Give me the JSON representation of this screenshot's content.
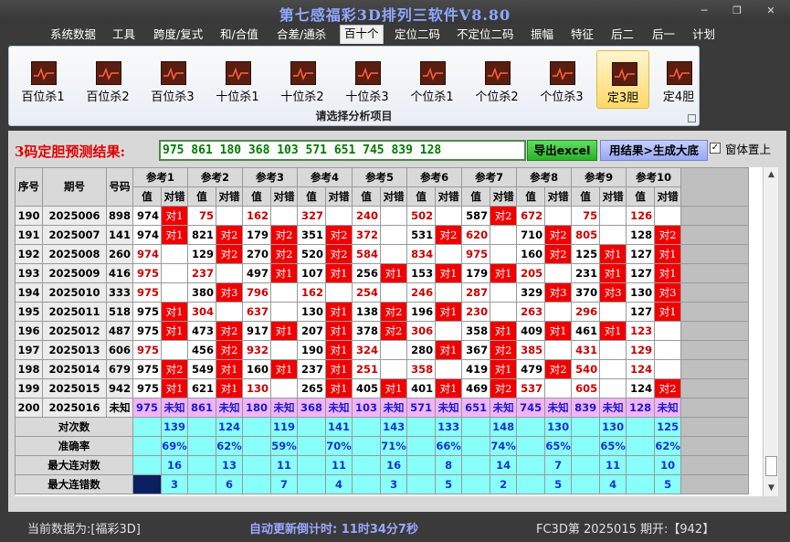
{
  "window": {
    "title": "第七感福彩3D排列三软件V8.80",
    "minimize_glyph": "─",
    "maximize_glyph": "❐",
    "close_glyph": "✕"
  },
  "menu": [
    {
      "label": "系统数据"
    },
    {
      "label": "工具"
    },
    {
      "label": "跨度/复式"
    },
    {
      "label": "和/合值"
    },
    {
      "label": "合差/通杀"
    },
    {
      "label": "百十个",
      "active": true
    },
    {
      "label": "定位二码"
    },
    {
      "label": "不定位二码"
    },
    {
      "label": "振幅"
    },
    {
      "label": "特征"
    },
    {
      "label": "后二"
    },
    {
      "label": "后一"
    },
    {
      "label": "计划"
    }
  ],
  "ribbon": {
    "buttons": [
      {
        "label": "百位杀1",
        "icon": "chart-icon"
      },
      {
        "label": "百位杀2",
        "icon": "chart-icon"
      },
      {
        "label": "百位杀3",
        "icon": "chart-icon"
      },
      {
        "label": "十位杀1",
        "icon": "chart-icon"
      },
      {
        "label": "十位杀2",
        "icon": "chart-icon"
      },
      {
        "label": "十位杀3",
        "icon": "chart-icon"
      },
      {
        "label": "个位杀1",
        "icon": "chart-icon"
      },
      {
        "label": "个位杀2",
        "icon": "chart-icon"
      },
      {
        "label": "个位杀3",
        "icon": "chart-icon"
      },
      {
        "label": "定3胆",
        "icon": "chart-icon",
        "active": true
      },
      {
        "label": "定4胆",
        "icon": "chart-icon"
      }
    ],
    "caption": "请选择分析项目"
  },
  "prediction": {
    "label": "3码定胆预测结果:",
    "value": "975 861 180 368 103 571 651 745 839 128",
    "export_label": "导出excel",
    "generate_label": "用结果>生成大底",
    "topmost_label": "窗体置上",
    "topmost_checked": "✓"
  },
  "table": {
    "headers": {
      "seq": "序号",
      "period": "期号",
      "code": "号码",
      "value": "值",
      "result": "对错"
    },
    "refs": [
      "参考1",
      "参考2",
      "参考3",
      "参考4",
      "参考5",
      "参考6",
      "参考7",
      "参考8",
      "参考9",
      "参考10"
    ],
    "rows": [
      {
        "seq": "190",
        "period": "2025006",
        "code": "898",
        "cells": [
          [
            "974",
            "对1"
          ],
          [
            "75",
            ""
          ],
          [
            "162",
            ""
          ],
          [
            "327",
            ""
          ],
          [
            "240",
            ""
          ],
          [
            "502",
            ""
          ],
          [
            "587",
            "对2"
          ],
          [
            "672",
            ""
          ],
          [
            "75",
            ""
          ],
          [
            "126",
            ""
          ]
        ]
      },
      {
        "seq": "191",
        "period": "2025007",
        "code": "141",
        "cells": [
          [
            "974",
            "对1"
          ],
          [
            "821",
            "对2"
          ],
          [
            "179",
            "对2"
          ],
          [
            "351",
            "对2"
          ],
          [
            "372",
            ""
          ],
          [
            "531",
            "对2"
          ],
          [
            "620",
            ""
          ],
          [
            "710",
            "对2"
          ],
          [
            "805",
            ""
          ],
          [
            "128",
            "对2"
          ]
        ]
      },
      {
        "seq": "192",
        "period": "2025008",
        "code": "260",
        "cells": [
          [
            "974",
            ""
          ],
          [
            "129",
            "对2"
          ],
          [
            "270",
            "对2"
          ],
          [
            "520",
            "对2"
          ],
          [
            "584",
            ""
          ],
          [
            "834",
            ""
          ],
          [
            "975",
            ""
          ],
          [
            "160",
            "对2"
          ],
          [
            "125",
            "对1"
          ],
          [
            "127",
            "对1"
          ]
        ]
      },
      {
        "seq": "193",
        "period": "2025009",
        "code": "416",
        "cells": [
          [
            "975",
            ""
          ],
          [
            "237",
            ""
          ],
          [
            "497",
            "对1"
          ],
          [
            "107",
            "对1"
          ],
          [
            "256",
            "对1"
          ],
          [
            "153",
            "对1"
          ],
          [
            "179",
            "对1"
          ],
          [
            "205",
            ""
          ],
          [
            "231",
            "对1"
          ],
          [
            "127",
            "对1"
          ]
        ]
      },
      {
        "seq": "194",
        "period": "2025010",
        "code": "333",
        "cells": [
          [
            "975",
            ""
          ],
          [
            "380",
            "对3"
          ],
          [
            "796",
            ""
          ],
          [
            "162",
            ""
          ],
          [
            "254",
            ""
          ],
          [
            "246",
            ""
          ],
          [
            "287",
            ""
          ],
          [
            "329",
            "对3"
          ],
          [
            "370",
            "对3"
          ],
          [
            "130",
            "对3"
          ]
        ]
      },
      {
        "seq": "195",
        "period": "2025011",
        "code": "518",
        "cells": [
          [
            "975",
            "对1"
          ],
          [
            "304",
            ""
          ],
          [
            "637",
            ""
          ],
          [
            "130",
            "对1"
          ],
          [
            "138",
            "对2"
          ],
          [
            "196",
            "对1"
          ],
          [
            "230",
            ""
          ],
          [
            "263",
            ""
          ],
          [
            "296",
            ""
          ],
          [
            "127",
            "对1"
          ]
        ]
      },
      {
        "seq": "196",
        "period": "2025012",
        "code": "487",
        "cells": [
          [
            "975",
            "对1"
          ],
          [
            "473",
            "对2"
          ],
          [
            "917",
            "对1"
          ],
          [
            "207",
            "对1"
          ],
          [
            "378",
            "对2"
          ],
          [
            "306",
            ""
          ],
          [
            "358",
            "对1"
          ],
          [
            "409",
            "对1"
          ],
          [
            "461",
            "对1"
          ],
          [
            "123",
            ""
          ]
        ]
      },
      {
        "seq": "197",
        "period": "2025013",
        "code": "606",
        "cells": [
          [
            "975",
            ""
          ],
          [
            "456",
            "对2"
          ],
          [
            "932",
            ""
          ],
          [
            "190",
            "对1"
          ],
          [
            "324",
            ""
          ],
          [
            "280",
            "对1"
          ],
          [
            "367",
            "对2"
          ],
          [
            "385",
            ""
          ],
          [
            "431",
            ""
          ],
          [
            "129",
            ""
          ]
        ]
      },
      {
        "seq": "198",
        "period": "2025014",
        "code": "679",
        "cells": [
          [
            "975",
            "对2"
          ],
          [
            "549",
            "对1"
          ],
          [
            "160",
            "对1"
          ],
          [
            "237",
            "对1"
          ],
          [
            "251",
            ""
          ],
          [
            "358",
            ""
          ],
          [
            "419",
            "对1"
          ],
          [
            "479",
            "对2"
          ],
          [
            "540",
            ""
          ],
          [
            "124",
            ""
          ]
        ]
      },
      {
        "seq": "199",
        "period": "2025015",
        "code": "942",
        "cells": [
          [
            "975",
            "对1"
          ],
          [
            "621",
            "对1"
          ],
          [
            "130",
            ""
          ],
          [
            "265",
            "对1"
          ],
          [
            "405",
            "对1"
          ],
          [
            "401",
            "对1"
          ],
          [
            "469",
            "对2"
          ],
          [
            "537",
            ""
          ],
          [
            "605",
            ""
          ],
          [
            "124",
            "对2"
          ]
        ]
      }
    ],
    "pending_row": {
      "seq": "200",
      "period": "2025016",
      "code": "未知",
      "values": [
        "975",
        "861",
        "180",
        "368",
        "103",
        "571",
        "651",
        "745",
        "839",
        "128"
      ],
      "unknown": "未知"
    },
    "summary": [
      {
        "label": "对次数",
        "values": [
          "139",
          "124",
          "119",
          "141",
          "143",
          "133",
          "148",
          "130",
          "130",
          "125"
        ]
      },
      {
        "label": "准确率",
        "values": [
          "69%",
          "62%",
          "59%",
          "70%",
          "71%",
          "66%",
          "74%",
          "65%",
          "65%",
          "62%"
        ]
      },
      {
        "label": "最大连对数",
        "values": [
          "16",
          "13",
          "11",
          "11",
          "16",
          "8",
          "14",
          "7",
          "11",
          "10"
        ]
      },
      {
        "label": "最大连错数",
        "values": [
          "3",
          "6",
          "7",
          "4",
          "3",
          "5",
          "2",
          "5",
          "4",
          "5"
        ]
      }
    ]
  },
  "status": {
    "left": "当前数据为:[福彩3D]",
    "countdown": "自动更新倒计时:  11时34分7秒",
    "right": "FC3D第 2025015 期开:【942】"
  }
}
